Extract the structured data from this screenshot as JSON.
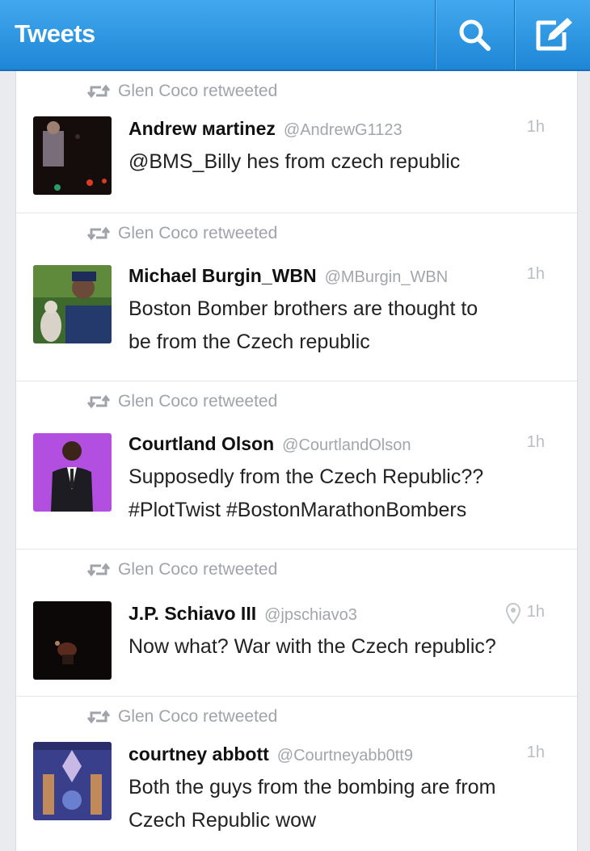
{
  "header": {
    "title": "Tweets"
  },
  "icons": {
    "search": "search-icon",
    "compose": "compose-icon",
    "retweet": "retweet-icon",
    "location": "location-pin-icon"
  },
  "colors": {
    "header_blue": "#1e86d6",
    "muted": "#a0a4aa",
    "text": "#222222"
  },
  "tweets": [
    {
      "retweeted_by": "Glen Coco retweeted",
      "name": "Andrew мartinez",
      "handle": "@AndrewG1123",
      "time": "1h",
      "text_lines": [
        "@BMS_Billy hes from czech republic"
      ]
    },
    {
      "retweeted_by": "Glen Coco retweeted",
      "name": "Michael Burgin_WBN",
      "handle": "@MBurgin_WBN",
      "time": "1h",
      "text_lines": [
        "Boston Bomber brothers are thought to",
        "be from the Czech republic"
      ]
    },
    {
      "retweeted_by": "Glen Coco retweeted",
      "name": "Courtland Olson",
      "handle": "@CourtlandOlson",
      "time": "1h",
      "text_lines": [
        "Supposedly from the Czech Republic??",
        "#PlotTwist #BostonMarathonBombers"
      ]
    },
    {
      "retweeted_by": "Glen Coco retweeted",
      "name": "J.P. Schiavo III",
      "handle": "@jpschiavo3",
      "time": "1h",
      "text_lines": [
        "Now what? War with the Czech republic?"
      ]
    },
    {
      "retweeted_by": "Glen Coco retweeted",
      "name": "courtney abbott",
      "handle": "@Courtneyabb0tt9",
      "time": "1h",
      "text_lines": [
        "Both the guys from the bombing are from",
        "Czech Republic wow"
      ]
    }
  ]
}
